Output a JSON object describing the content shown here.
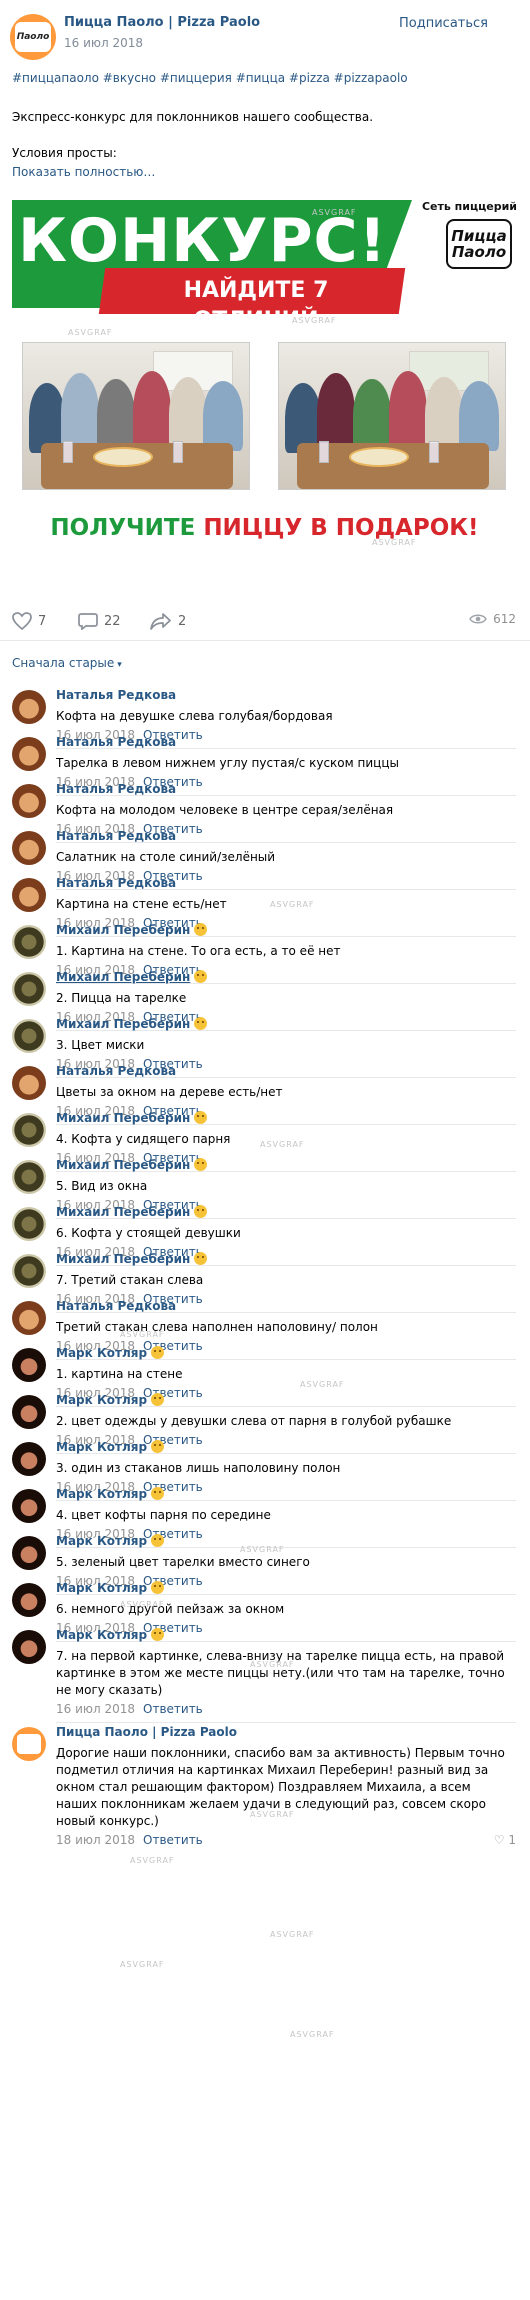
{
  "post": {
    "author": "Пицца Паоло | Pizza Paolo",
    "date": "16 июл 2018",
    "subscribe": "Подписаться",
    "hashtags": "#пиццапаоло #вкусно #пиццерия #пицца #pizza #pizzapaolo",
    "text_line1": "Экспресс-конкурс для поклонников нашего сообщества.",
    "text_line2": "Условия просты:",
    "show_more": "Показать полностью…",
    "avatar_text": "Паоло"
  },
  "banner": {
    "title": "КОНКУРС!",
    "subtitle": "НАЙДИТЕ 7 ОТЛИЧИЙ",
    "logo_top": "Сеть пиццерий",
    "logo_name": "Пицца Паоло",
    "bottom_green": "ПОЛУЧИТЕ ",
    "bottom_red": "ПИЦЦУ В ПОДАРОК!"
  },
  "watermark": "ASVGRAF",
  "actions": {
    "likes": "7",
    "comments": "22",
    "shares": "2",
    "views": "612"
  },
  "sort_label": "Сначала старые",
  "reply_label": "Ответить",
  "comments": [
    {
      "author": "Наталья Редкова",
      "text": "Кофта на девушке слева голубая/бордовая",
      "date": "16 июл 2018"
    },
    {
      "author": "Наталья Редкова",
      "text": "Тарелка в левом нижнем углу пустая/с куском пиццы",
      "date": "16 июл 2018"
    },
    {
      "author": "Наталья Редкова",
      "text": "Кофта на молодом человеке в центре серая/зелёная",
      "date": "16 июл 2018"
    },
    {
      "author": "Наталья Редкова",
      "text": "Салатник на столе синий/зелёный",
      "date": "16 июл 2018"
    },
    {
      "author": "Наталья Редкова",
      "text": "Картина на стене есть/нет",
      "date": "16 июл 2018"
    },
    {
      "author": "Михаил Переберин",
      "text": "1. Картина на стене. То ога есть, а то её нет",
      "date": "16 июл 2018"
    },
    {
      "author": "Михаил Переберин",
      "text": "2. Пицца на тарелке",
      "date": "16 июл 2018"
    },
    {
      "author": "Михаил Переберин",
      "text": "3. Цвет миски",
      "date": "16 июл 2018"
    },
    {
      "author": "Наталья Редкова",
      "text": "Цветы за окном на дереве есть/нет",
      "date": "16 июл 2018"
    },
    {
      "author": "Михаил Переберин",
      "text": "4. Кофта у сидящего парня",
      "date": "16 июл 2018"
    },
    {
      "author": "Михаил Переберин",
      "text": "5. Вид из окна",
      "date": "16 июл 2018"
    },
    {
      "author": "Михаил Переберин",
      "text": "6. Кофта у стоящей девушки",
      "date": "16 июл 2018"
    },
    {
      "author": "Михаил Переберин",
      "text": "7. Третий стакан слева",
      "date": "16 июл 2018"
    },
    {
      "author": "Наталья Редкова",
      "text": "Третий стакан слева наполнен наполовину/ полон",
      "date": "16 июл 2018"
    },
    {
      "author": "Марк Котляр",
      "text": "1. картина на стене",
      "date": "16 июл 2018"
    },
    {
      "author": "Марк Котляр",
      "text": "2. цвет одежды у девушки слева от парня в голубой рубашке",
      "date": "16 июл 2018"
    },
    {
      "author": "Марк Котляр",
      "text": "3. один из стаканов лишь наполовину полон",
      "date": "16 июл 2018"
    },
    {
      "author": "Марк Котляр",
      "text": "4. цвет кофты парня по середине",
      "date": "16 июл 2018"
    },
    {
      "author": "Марк Котляр",
      "text": "5. зеленый цвет тарелки вместо синего",
      "date": "16 июл 2018"
    },
    {
      "author": "Марк Котляр",
      "text": "6. немного другой пейзаж за окном",
      "date": "16 июл 2018"
    },
    {
      "author": "Марк Котляр",
      "text": "7. на первой картинке, слева-внизу на тарелке пицца есть, на правой картинке в этом же месте пиццы нету.(или что там на тарелке, точно не могу сказать)",
      "date": "16 июл 2018"
    },
    {
      "author": "Пицца Паоло | Pizza Paolo",
      "text": "Дорогие наши поклонники, спасибо вам за активность) Первым точно подметил отличия на картинках Михаил Переберин! разный вид за окном стал решающим фактором) Поздравляем Михаила, а всем наших поклонникам желаем удачи в следующий раз, совсем скоро новый конкурс.)",
      "date": "18 июл 2018",
      "likes": "1"
    }
  ]
}
